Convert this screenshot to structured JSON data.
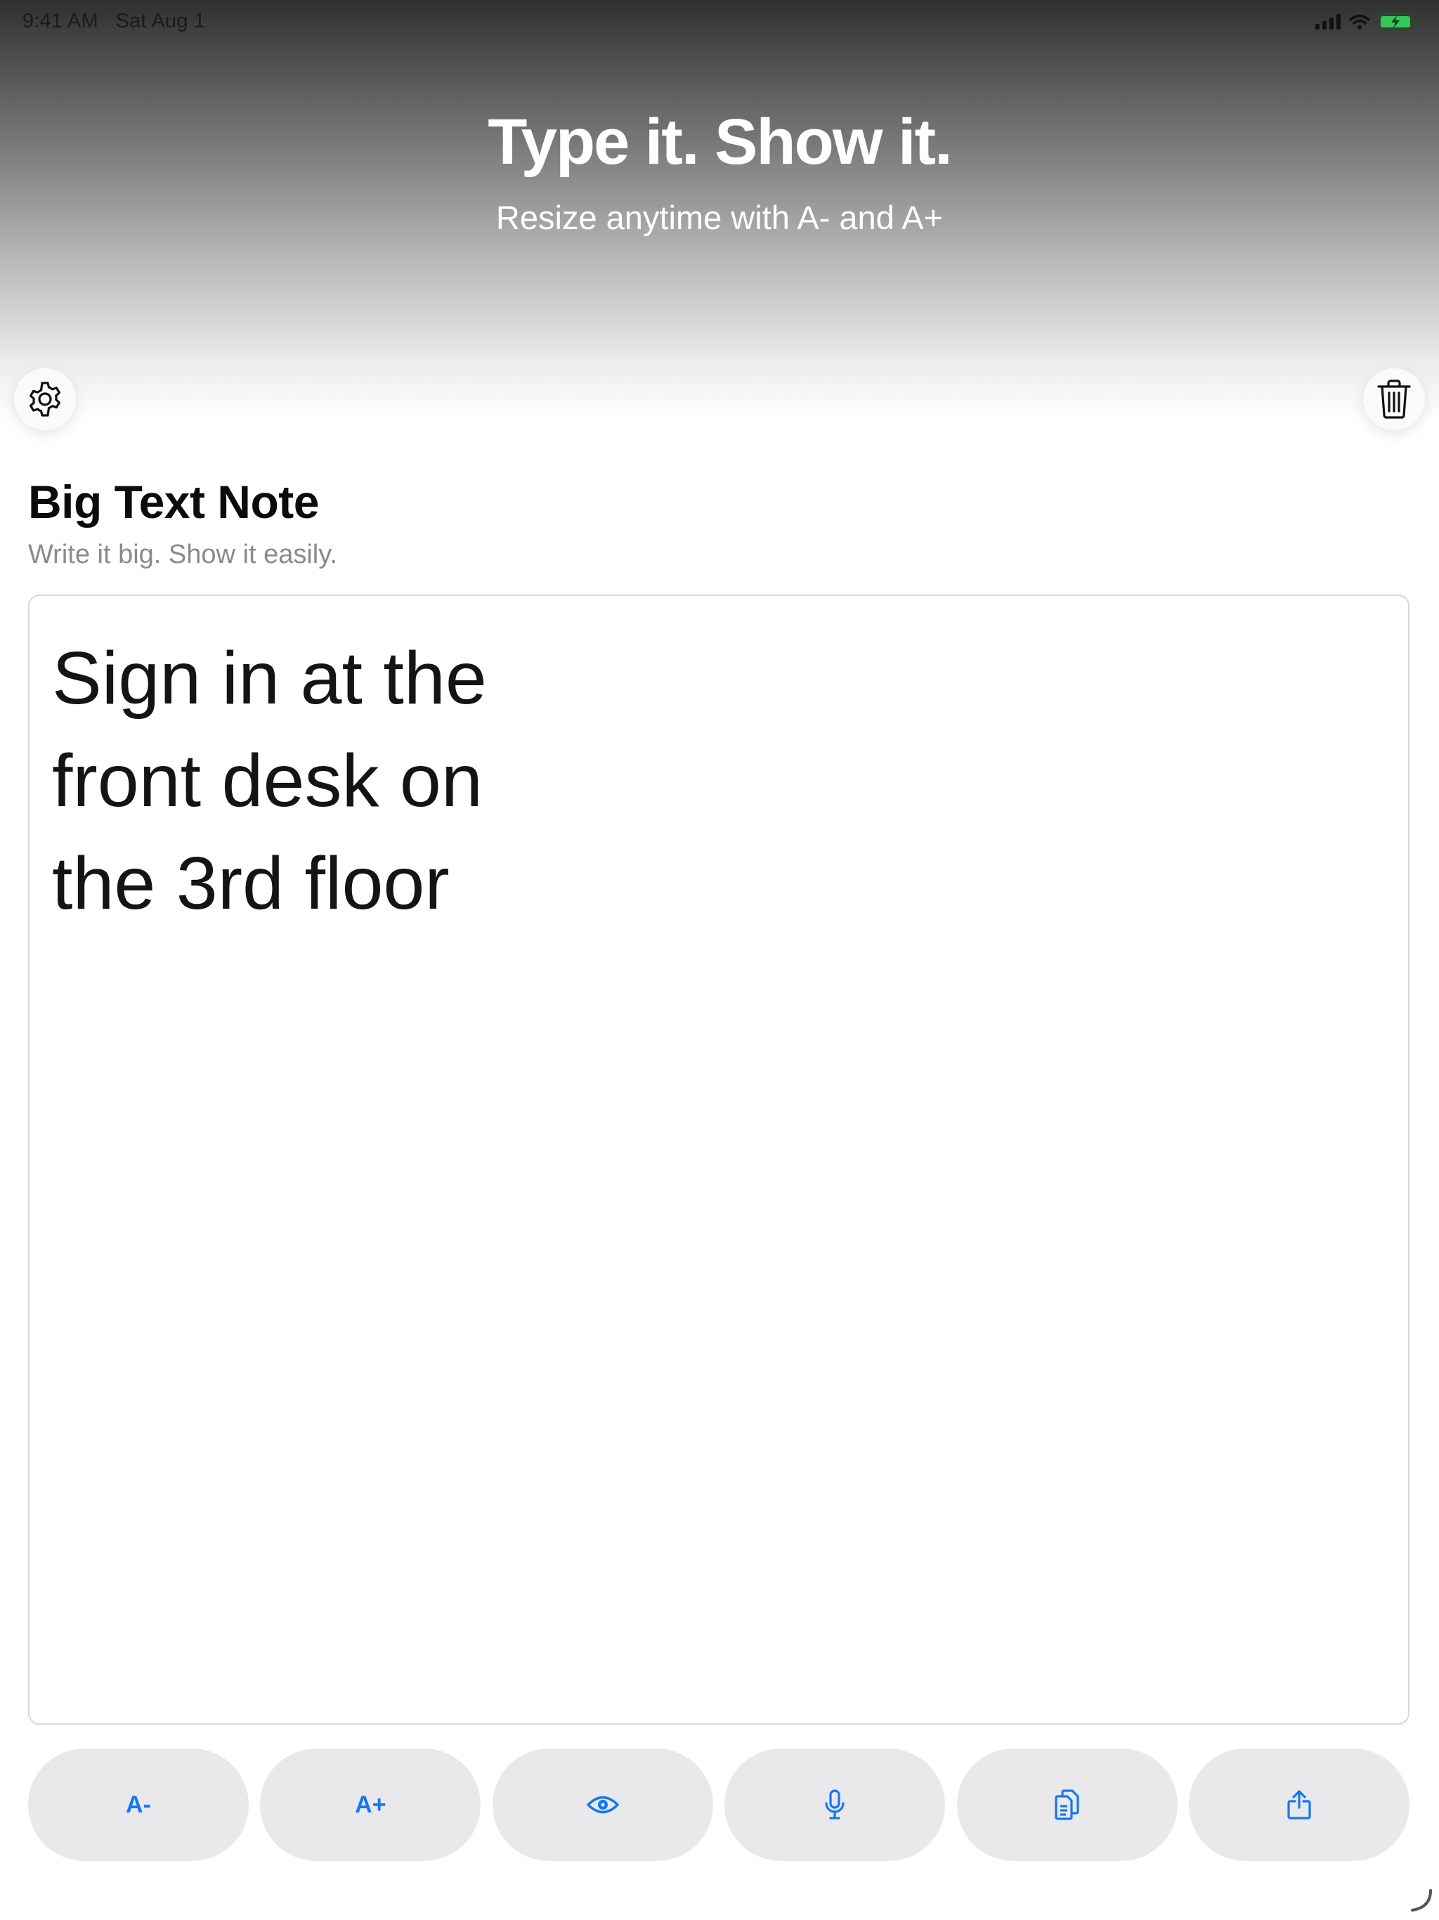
{
  "status_bar": {
    "time": "9:41 AM",
    "date": "Sat Aug 1",
    "icons": [
      "cellular-signal-icon",
      "wifi-icon",
      "battery-charging-icon"
    ]
  },
  "hero": {
    "title": "Type it. Show it.",
    "subtitle": "Resize anytime with A- and A+"
  },
  "top_actions": {
    "settings_icon": "gear-icon",
    "delete_icon": "trash-icon"
  },
  "note": {
    "title": "Big Text Note",
    "subtitle": "Write it big. Show it easily.",
    "text": "Sign in at the\nfront desk on\nthe 3rd floor"
  },
  "toolbar": {
    "decrease_label": "A-",
    "increase_label": "A+",
    "preview_icon": "eye-icon",
    "dictate_icon": "microphone-icon",
    "copy_icon": "copy-icon",
    "share_icon": "share-icon"
  },
  "colors": {
    "accent": "#1478f2",
    "button_bg": "#e9e9eb",
    "subtitle_gray": "#8a8a8e",
    "battery_green": "#34c759"
  }
}
